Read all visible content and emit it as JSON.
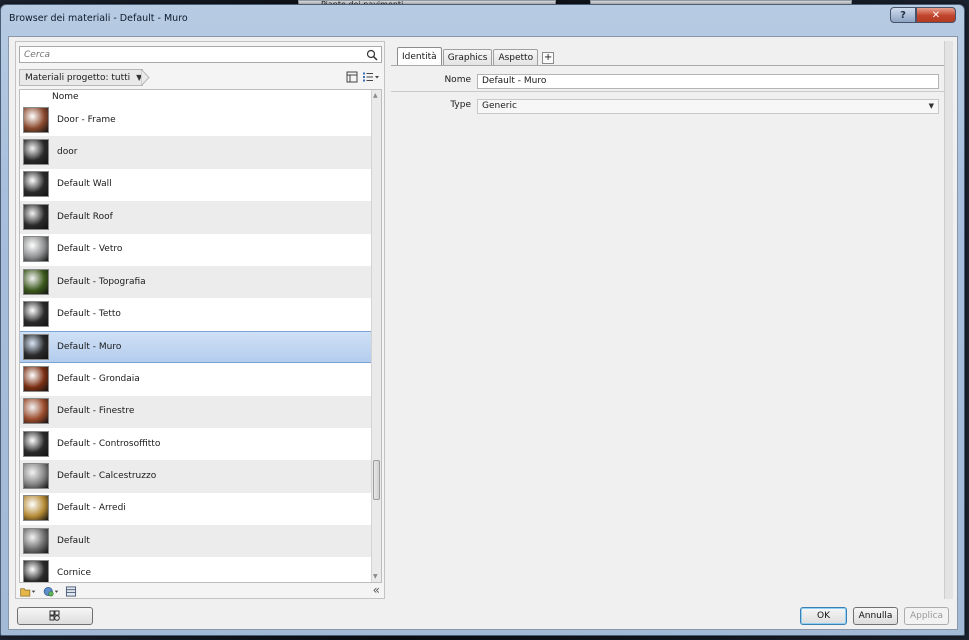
{
  "background": {
    "strip_label": "Piante dei pavimenti"
  },
  "window": {
    "title": "Browser dei materiali - Default - Muro",
    "help_label": "?",
    "close_label": "✕"
  },
  "left_panel": {
    "search": {
      "placeholder": "Cerca",
      "value": ""
    },
    "filter": {
      "label": "Materiali progetto: tutti"
    },
    "list": {
      "header": "Nome",
      "items": [
        {
          "label": "Door - Frame",
          "color": "#8a4a2e"
        },
        {
          "label": "door",
          "color": "#2a2a2a"
        },
        {
          "label": "Default Wall",
          "color": "#2a2a2a"
        },
        {
          "label": "Default Roof",
          "color": "#2a2a2a"
        },
        {
          "label": "Default - Vetro",
          "color": "#8d8f90"
        },
        {
          "label": "Default - Topografia",
          "color": "#3d5a1e"
        },
        {
          "label": "Default - Tetto",
          "color": "#2a2a2a"
        },
        {
          "label": "Default - Muro",
          "color": "#2a2a2a",
          "selected": true
        },
        {
          "label": "Default - Grondaia",
          "color": "#7a2f12"
        },
        {
          "label": "Default - Finestre",
          "color": "#9a4b2c"
        },
        {
          "label": "Default - Controsoffitto",
          "color": "#2a2a2a"
        },
        {
          "label": "Default - Calcestruzzo",
          "color": "#858585"
        },
        {
          "label": "Default - Arredi",
          "color": "#b58a35"
        },
        {
          "label": "Default",
          "color": "#6d6d6d"
        },
        {
          "label": "Cornice",
          "color": "#2a2a2a"
        }
      ]
    },
    "collapse_label": "«"
  },
  "tabs": [
    {
      "label": "Identità",
      "active": true
    },
    {
      "label": "Graphics",
      "active": false
    },
    {
      "label": "Aspetto",
      "active": false
    }
  ],
  "add_tab_label": "+",
  "properties": {
    "name_label": "Nome",
    "name_value": "Default - Muro",
    "type_label": "Type",
    "type_value": "Generic"
  },
  "buttons": {
    "ok": "OK",
    "cancel": "Annulla",
    "apply": "Applica"
  },
  "colors": {
    "selection": "#b4cdee",
    "title_bar": "#a7bfdc",
    "close_button": "#c1432b"
  }
}
